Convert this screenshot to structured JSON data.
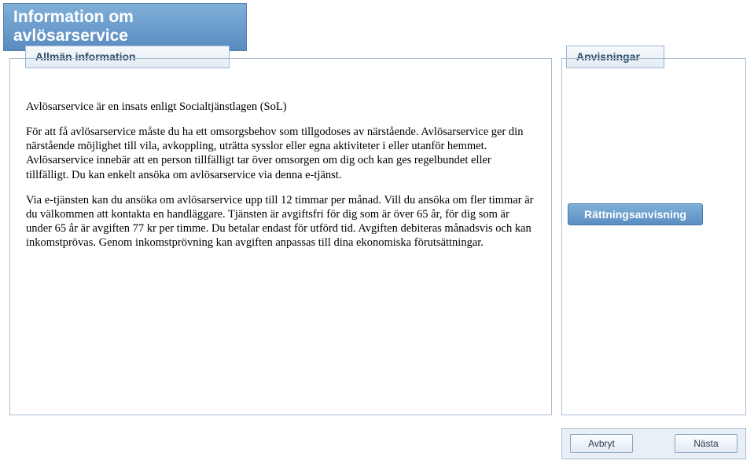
{
  "header": {
    "title": "Information om avlösarservice"
  },
  "tabs": {
    "left": "Allmän information",
    "right": "Anvisningar"
  },
  "content": {
    "para1": "Avlösarservice är en insats enligt Socialtjänstlagen (SoL)",
    "para2": "För att få avlösarservice måste du ha ett omsorgsbehov som tillgodoses av närstående. Avlösarservice ger din närstående möjlighet till vila, avkoppling, uträtta sysslor eller egna aktiviteter i eller utanför hemmet. Avlösarservice innebär att en person tillfälligt tar över omsorgen om dig och kan ges regelbundet eller tillfälligt. Du kan enkelt ansöka om avlösarservice via denna e-tjänst.",
    "para3": "Via e-tjänsten kan du ansöka om avlösarservice upp till 12 timmar per månad. Vill du ansöka om fler timmar är du välkommen att kontakta en handläggare. Tjänsten är avgiftsfri för dig som är över 65 år, för dig som är under 65 år är avgiften 77 kr per timme. Du betalar endast för utförd tid. Avgiften debiteras månadsvis och kan inkomstprövas. Genom inkomstprövning kan avgiften anpassas till dina ekonomiska förutsättningar."
  },
  "sidebar": {
    "pill": "Rättningsanvisning"
  },
  "footer": {
    "cancel": "Avbryt",
    "next": "Nästa"
  }
}
